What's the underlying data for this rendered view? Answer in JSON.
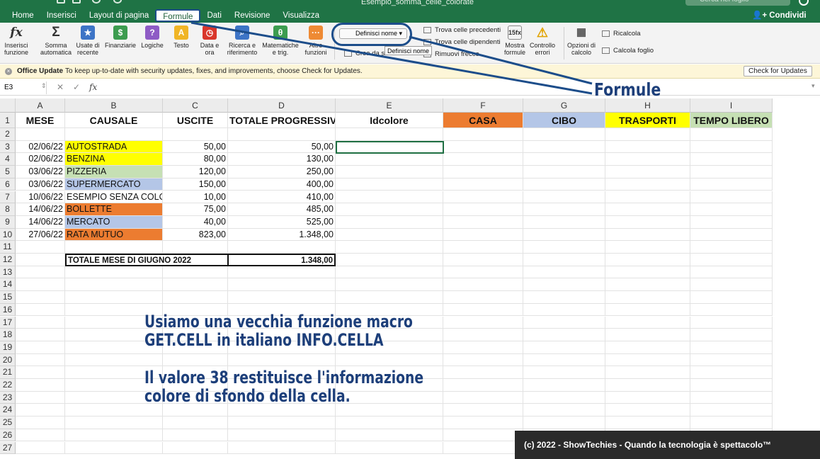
{
  "window": {
    "title": "Esempio_somma_celle_colorate",
    "search_placeholder": "Cerca nel foglio",
    "share_label": "Condividi"
  },
  "tabs": [
    "Home",
    "Inserisci",
    "Layout di pagina",
    "Formule",
    "Dati",
    "Revisione",
    "Visualizza"
  ],
  "active_tab": "Formule",
  "ribbon": {
    "insert_function": "Inserisci funzione",
    "autosum": "Somma automatica",
    "recent": "Usate di recente",
    "financial": "Finanziarie",
    "logical": "Logiche",
    "text": "Testo",
    "date_time": "Data e ora",
    "lookup": "Ricerca e riferimento",
    "math": "Matematiche e trig.",
    "more": "Altre funzioni",
    "define_name": "Definisci nome",
    "create_from": "Crea da se",
    "trace_precedents": "Trova celle precedenti",
    "trace_dependents": "Trova celle dipendenti",
    "remove_arrows": "Rimuovi frecce",
    "show_formulas": "Mostra formule",
    "error_check": "Controllo errori",
    "calc_options": "Opzioni di calcolo",
    "calc_now": "Ricalcola",
    "calc_sheet": "Calcola foglio",
    "tooltip": "Definisci nome"
  },
  "update_bar": {
    "title": "Office Update",
    "message": "To keep up-to-date with security updates, fixes, and improvements, choose Check for Updates.",
    "button": "Check for Updates"
  },
  "formula_bar": {
    "name_box": "E3",
    "content": ""
  },
  "columns": [
    "A",
    "B",
    "C",
    "D",
    "E",
    "F",
    "G",
    "H",
    "I"
  ],
  "rows": [
    "1",
    "2",
    "3",
    "4",
    "5",
    "6",
    "7",
    "8",
    "9",
    "10",
    "11",
    "12",
    "13",
    "14",
    "15",
    "16",
    "17",
    "18",
    "19",
    "20",
    "21",
    "22",
    "23",
    "24",
    "25",
    "26",
    "27"
  ],
  "headers": {
    "A": "MESE",
    "B": "CAUSALE",
    "C": "USCITE",
    "D": "TOTALE PROGRESSIVO",
    "E": "Idcolore",
    "F": "CASA",
    "G": "CIBO",
    "H": "TRASPORTI",
    "I": "TEMPO LIBERO"
  },
  "header_colors": {
    "F": "#ec7c30",
    "G": "#b4c6e7",
    "H": "#ffff00",
    "I": "#c6e0b4"
  },
  "data_rows": [
    {
      "row": "3",
      "date": "02/06/22",
      "causale": "AUTOSTRADA",
      "uscite": "50,00",
      "totale": "50,00",
      "color": "#ffff00"
    },
    {
      "row": "4",
      "date": "02/06/22",
      "causale": "BENZINA",
      "uscite": "80,00",
      "totale": "130,00",
      "color": "#ffff00"
    },
    {
      "row": "5",
      "date": "03/06/22",
      "causale": "PIZZERIA",
      "uscite": "120,00",
      "totale": "250,00",
      "color": "#c6e0b4"
    },
    {
      "row": "6",
      "date": "03/06/22",
      "causale": "SUPERMERCATO",
      "uscite": "150,00",
      "totale": "400,00",
      "color": "#b4c6e7"
    },
    {
      "row": "7",
      "date": "10/06/22",
      "causale": "ESEMPIO SENZA COLORE",
      "uscite": "10,00",
      "totale": "410,00",
      "color": ""
    },
    {
      "row": "8",
      "date": "14/06/22",
      "causale": "BOLLETTE",
      "uscite": "75,00",
      "totale": "485,00",
      "color": "#ec7c30"
    },
    {
      "row": "9",
      "date": "14/06/22",
      "causale": "MERCATO",
      "uscite": "40,00",
      "totale": "525,00",
      "color": "#b4c6e7"
    },
    {
      "row": "10",
      "date": "27/06/22",
      "causale": "RATA MUTUO",
      "uscite": "823,00",
      "totale": "1.348,00",
      "color": "#ec7c30"
    }
  ],
  "total_row": {
    "label": "TOTALE MESE DI GIUGNO 2022",
    "value": "1.348,00"
  },
  "annotations": {
    "formule": "Formule",
    "line1": "Usiamo una vecchia funzione macro",
    "line2": "GET.CELL in italiano INFO.CELLA",
    "line3": "Il valore 38 restituisce l'informazione",
    "line4": "colore di sfondo della cella.",
    "copyright": "(c) 2022 - ShowTechies - Quando la tecnologia è spettacolo™"
  },
  "colors": {
    "excel_green": "#1f7345",
    "annotation_blue": "#1d3f7a"
  }
}
